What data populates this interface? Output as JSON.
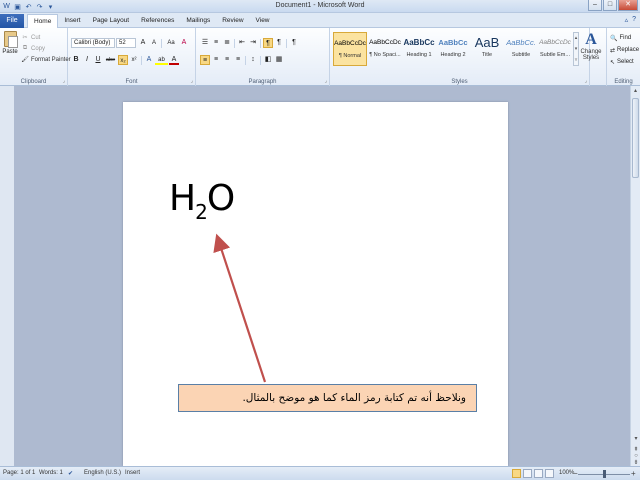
{
  "window": {
    "title": "Document1 - Microsoft Word",
    "qat_icons": [
      "word-logo-icon",
      "save-icon",
      "undo-icon",
      "redo-icon",
      "customize-icon"
    ]
  },
  "tabs": {
    "file": "File",
    "items": [
      "Home",
      "Insert",
      "Page Layout",
      "References",
      "Mailings",
      "Review",
      "View"
    ],
    "active": "Home"
  },
  "ribbon": {
    "clipboard": {
      "label": "Clipboard",
      "paste": "Paste",
      "cut": "Cut",
      "copy": "Copy",
      "format_painter": "Format Painter"
    },
    "font": {
      "label": "Font",
      "font_name": "Calibri (Body)",
      "font_size": "52",
      "grow": "A",
      "shrink": "A",
      "change_case": "Aa",
      "clear": "A",
      "bold": "B",
      "italic": "I",
      "underline": "U",
      "strike": "abe",
      "subscript": "x₂",
      "superscript": "x²",
      "text_effects": "A",
      "highlight": "ab",
      "font_color": "A"
    },
    "paragraph": {
      "label": "Paragraph"
    },
    "styles": {
      "label": "Styles",
      "items": [
        {
          "sample": "AaBbCcDc",
          "name": "¶ Normal"
        },
        {
          "sample": "AaBbCcDc",
          "name": "¶ No Spaci..."
        },
        {
          "sample": "AaBbCc",
          "name": "Heading 1"
        },
        {
          "sample": "AaBbCc",
          "name": "Heading 2"
        },
        {
          "sample": "AaB",
          "name": "Title"
        },
        {
          "sample": "AaBbCc.",
          "name": "Subtitle"
        },
        {
          "sample": "AaBbCcDc",
          "name": "Subtle Em..."
        }
      ],
      "change_styles": "Change Styles"
    },
    "editing": {
      "label": "Editing",
      "find": "Find",
      "replace": "Replace",
      "select": "Select"
    }
  },
  "document": {
    "formula_main": "H",
    "formula_sub": "2",
    "formula_end": "O",
    "callout_text": "ونلاحظ أنه تم كتابة رمز الماء كما هو موضح بالمثال."
  },
  "status": {
    "page": "Page: 1 of 1",
    "words": "Words: 1",
    "language": "English (U.S.)",
    "mode": "Insert",
    "zoom": "100%"
  },
  "colors": {
    "arrow": "#c0504d",
    "callout_fill": "#fbd4b4",
    "file_tab": "#2356a6"
  }
}
